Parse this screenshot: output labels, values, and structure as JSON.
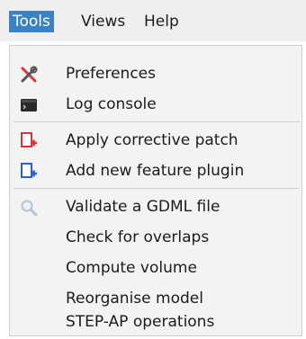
{
  "menubar": {
    "tools": "Tools",
    "views": "Views",
    "help": "Help"
  },
  "menu": {
    "items": [
      {
        "label": "Preferences",
        "icon": "tools-icon"
      },
      {
        "label": "Log console",
        "icon": "terminal-icon"
      },
      {
        "label": "Apply corrective patch",
        "icon": "patch-plugin-icon"
      },
      {
        "label": "Add new feature plugin",
        "icon": "feature-plugin-icon"
      },
      {
        "label": "Validate a GDML file",
        "icon": "magnifier-icon"
      },
      {
        "label": "Check for overlaps"
      },
      {
        "label": "Compute volume"
      },
      {
        "label": "Reorganise model"
      },
      {
        "label": "STEP-AP operations"
      }
    ]
  },
  "colors": {
    "highlight": "#3b82c4",
    "patch_icon": "#d9343b",
    "feature_icon": "#2b5fc9"
  }
}
